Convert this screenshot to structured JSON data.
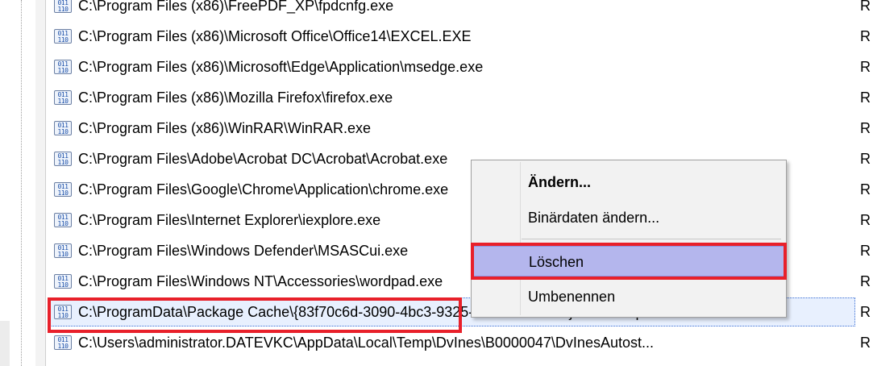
{
  "list": {
    "rows": [
      {
        "name": "C:\\Program Files (x86)\\FreePDF_XP\\fpdcnfg.exe",
        "type": "R",
        "icon": "binary-value-icon"
      },
      {
        "name": "C:\\Program Files (x86)\\Microsoft Office\\Office14\\EXCEL.EXE",
        "type": "R",
        "icon": "binary-value-icon"
      },
      {
        "name": "C:\\Program Files (x86)\\Microsoft\\Edge\\Application\\msedge.exe",
        "type": "R",
        "icon": "binary-value-icon"
      },
      {
        "name": "C:\\Program Files (x86)\\Mozilla Firefox\\firefox.exe",
        "type": "R",
        "icon": "binary-value-icon"
      },
      {
        "name": "C:\\Program Files (x86)\\WinRAR\\WinRAR.exe",
        "type": "R",
        "icon": "binary-value-icon"
      },
      {
        "name": "C:\\Program Files\\Adobe\\Acrobat DC\\Acrobat\\Acrobat.exe",
        "type": "R",
        "icon": "binary-value-icon"
      },
      {
        "name": "C:\\Program Files\\Google\\Chrome\\Application\\chrome.exe",
        "type": "R",
        "icon": "binary-value-icon"
      },
      {
        "name": "C:\\Program Files\\Internet Explorer\\iexplore.exe",
        "type": "R",
        "icon": "binary-value-icon"
      },
      {
        "name": "C:\\Program Files\\Windows Defender\\MSASCui.exe",
        "type": "R",
        "icon": "binary-value-icon"
      },
      {
        "name": "C:\\Program Files\\Windows NT\\Accessories\\wordpad.exe",
        "type": "R",
        "icon": "binary-value-icon"
      },
      {
        "name": "C:\\ProgramData\\Package Cache\\{83f70c6d-3090-4bc3-9325-20250340ecc5}\\SiPacompa...",
        "type": "R",
        "icon": "binary-value-icon",
        "selected": true
      },
      {
        "name": "C:\\Users\\administrator.DATEVKC\\AppData\\Local\\Temp\\DvInes\\B0000047\\DvInesAutost...",
        "type": "R",
        "icon": "binary-value-icon"
      }
    ]
  },
  "context_menu": {
    "items": [
      {
        "label": "Ändern...",
        "bold": true
      },
      {
        "label": "Binärdaten ändern..."
      },
      {
        "label": "Löschen",
        "hover": true
      },
      {
        "label": "Umbenennen"
      }
    ]
  },
  "colors": {
    "highlight_red": "#e8202a",
    "menu_hover": "#b4b6ed",
    "selection_border": "#3b6fd4"
  }
}
